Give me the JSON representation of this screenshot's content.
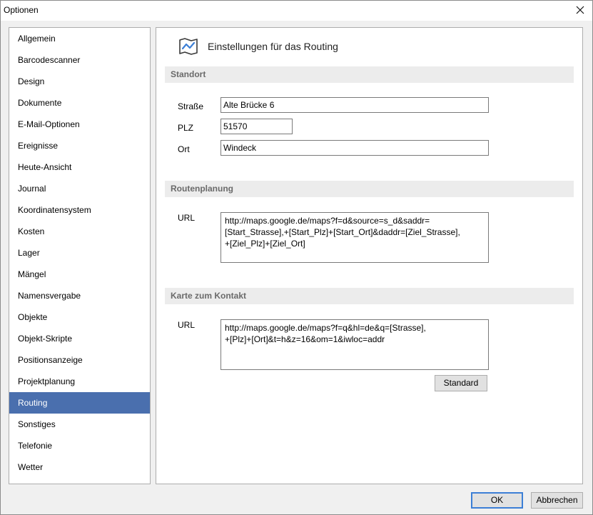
{
  "window": {
    "title": "Optionen",
    "close_icon": "close-icon"
  },
  "sidebar": {
    "selected": "Routing",
    "items": [
      {
        "label": "Allgemein"
      },
      {
        "label": "Barcodescanner"
      },
      {
        "label": "Design"
      },
      {
        "label": "Dokumente"
      },
      {
        "label": "E-Mail-Optionen"
      },
      {
        "label": "Ereignisse"
      },
      {
        "label": "Heute-Ansicht"
      },
      {
        "label": "Journal"
      },
      {
        "label": "Koordinatensystem"
      },
      {
        "label": "Kosten"
      },
      {
        "label": "Lager"
      },
      {
        "label": "Mängel"
      },
      {
        "label": "Namensvergabe"
      },
      {
        "label": "Objekte"
      },
      {
        "label": "Objekt-Skripte"
      },
      {
        "label": "Positionsanzeige"
      },
      {
        "label": "Projektplanung"
      },
      {
        "label": "Routing"
      },
      {
        "label": "Sonstiges"
      },
      {
        "label": "Telefonie"
      },
      {
        "label": "Wetter"
      }
    ]
  },
  "content": {
    "header_icon": "route-map-icon",
    "header_title": "Einstellungen für das Routing",
    "standort": {
      "title": "Standort",
      "strasse_label": "Straße",
      "strasse_value": "Alte Brücke 6",
      "plz_label": "PLZ",
      "plz_value": "51570",
      "ort_label": "Ort",
      "ort_value": "Windeck"
    },
    "routenplanung": {
      "title": "Routenplanung",
      "url_label": "URL",
      "url_value": "http://maps.google.de/maps?f=d&source=s_d&saddr=\n[Start_Strasse],+[Start_Plz]+[Start_Ort]&daddr=[Ziel_Strasse],\n+[Ziel_Plz]+[Ziel_Ort]"
    },
    "karte": {
      "title": "Karte zum Kontakt",
      "url_label": "URL",
      "url_value": "http://maps.google.de/maps?f=q&hl=de&q=[Strasse],\n+[Plz]+[Ort]&t=h&z=16&om=1&iwloc=addr",
      "standard_label": "Standard"
    }
  },
  "footer": {
    "ok_label": "OK",
    "cancel_label": "Abbrechen"
  },
  "colors": {
    "selection": "#4a6fae",
    "section_bar": "#ececec",
    "ok_border": "#3c7fd6"
  }
}
